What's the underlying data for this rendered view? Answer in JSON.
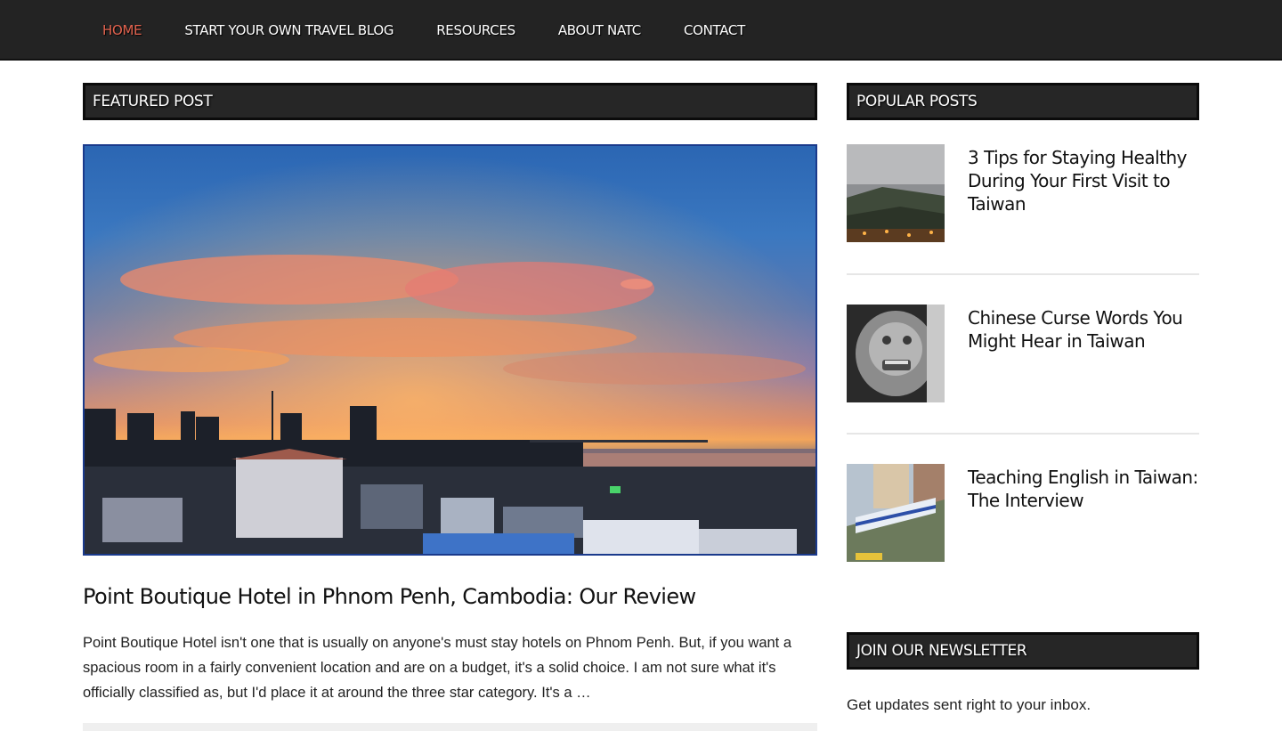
{
  "nav": {
    "items": [
      {
        "label": "HOME",
        "active": true
      },
      {
        "label": "START YOUR OWN TRAVEL BLOG",
        "active": false
      },
      {
        "label": "RESOURCES",
        "active": false
      },
      {
        "label": "ABOUT NATC",
        "active": false
      },
      {
        "label": "CONTACT",
        "active": false
      }
    ],
    "active_color": "#e0624e"
  },
  "featured": {
    "heading": "FEATURED POST",
    "title": "Point Boutique Hotel in Phnom Penh, Cambodia: Our Review",
    "excerpt": "Point Boutique Hotel isn't one that is usually on anyone's must stay hotels on Phnom Penh. But, if you want a spacious room in a fairly convenient location and are on a budget, it's a solid choice. I am not sure what it's officially classified as, but I'd place it at around the three star category. It's a …"
  },
  "popular": {
    "heading": "POPULAR POSTS",
    "items": [
      {
        "title": "3 Tips for Staying Healthy During Your First Visit to Taiwan"
      },
      {
        "title": "Chinese Curse Words You Might Hear in Taiwan"
      },
      {
        "title": "Teaching English in Taiwan: The Interview"
      }
    ]
  },
  "newsletter": {
    "heading": "JOIN OUR NEWSLETTER",
    "text": "Get updates sent right to your inbox."
  }
}
